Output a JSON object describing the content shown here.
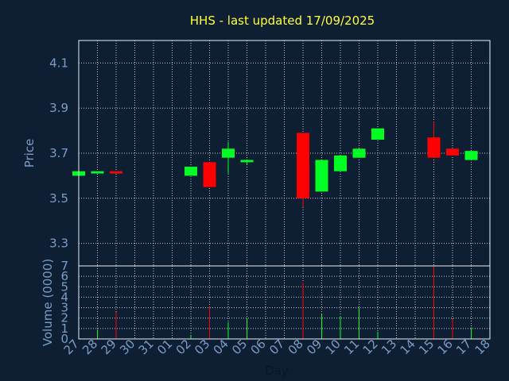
{
  "colors": {
    "background": "#0f1f33",
    "title": "#ffff33",
    "axis_text": "#7a9cc6",
    "up": "#00ff22",
    "down": "#ff0000",
    "frame": "#e8eef4"
  },
  "chart_data": [
    {
      "type": "candlestick",
      "title": "HHS - last updated 17/09/2025",
      "ylabel": "Price",
      "ylim": [
        3.2,
        4.2
      ],
      "yticks": [
        "3.3",
        "3.5",
        "3.7",
        "3.9",
        "4.1"
      ],
      "grid": true,
      "x_labels": [
        "27",
        "28",
        "29",
        "30",
        "31",
        "01",
        "02",
        "03",
        "04",
        "05",
        "06",
        "07",
        "08",
        "09",
        "10",
        "11",
        "12",
        "13",
        "14",
        "15",
        "16",
        "17",
        "18"
      ],
      "candles": [
        {
          "day": "27",
          "open": 3.6,
          "close": 3.62,
          "high": 3.62,
          "low": 3.6
        },
        {
          "day": "28",
          "open": 3.61,
          "close": 3.62,
          "high": 3.62,
          "low": 3.61
        },
        {
          "day": "29",
          "open": 3.62,
          "close": 3.61,
          "high": 3.62,
          "low": 3.61
        },
        {
          "day": "02",
          "open": 3.6,
          "close": 3.64,
          "high": 3.64,
          "low": 3.6
        },
        {
          "day": "03",
          "open": 3.66,
          "close": 3.55,
          "high": 3.66,
          "low": 3.55
        },
        {
          "day": "04",
          "open": 3.68,
          "close": 3.72,
          "high": 3.75,
          "low": 3.61
        },
        {
          "day": "05",
          "open": 3.66,
          "close": 3.67,
          "high": 3.67,
          "low": 3.65
        },
        {
          "day": "08",
          "open": 3.79,
          "close": 3.5,
          "high": 3.79,
          "low": 3.46
        },
        {
          "day": "09",
          "open": 3.53,
          "close": 3.67,
          "high": 3.67,
          "low": 3.53
        },
        {
          "day": "10",
          "open": 3.62,
          "close": 3.69,
          "high": 3.69,
          "low": 3.62
        },
        {
          "day": "11",
          "open": 3.68,
          "close": 3.72,
          "high": 3.72,
          "low": 3.68
        },
        {
          "day": "12",
          "open": 3.76,
          "close": 3.81,
          "high": 3.81,
          "low": 3.76
        },
        {
          "day": "15",
          "open": 3.77,
          "close": 3.68,
          "high": 3.84,
          "low": 3.68
        },
        {
          "day": "16",
          "open": 3.72,
          "close": 3.69,
          "high": 3.72,
          "low": 3.69
        },
        {
          "day": "17",
          "open": 3.67,
          "close": 3.71,
          "high": 3.71,
          "low": 3.67
        }
      ]
    },
    {
      "type": "bar",
      "ylabel": "Volume (0000)",
      "xlabel": "Day",
      "ylim": [
        0,
        7
      ],
      "yticks": [
        "0",
        "1",
        "2",
        "3",
        "4",
        "5",
        "6",
        "7"
      ],
      "grid": true,
      "bars": [
        {
          "day": "28",
          "value": 0.9,
          "direction": "up"
        },
        {
          "day": "29",
          "value": 2.6,
          "direction": "down"
        },
        {
          "day": "02",
          "value": 0.4,
          "direction": "up"
        },
        {
          "day": "03",
          "value": 3.1,
          "direction": "down"
        },
        {
          "day": "04",
          "value": 1.6,
          "direction": "up"
        },
        {
          "day": "05",
          "value": 2.0,
          "direction": "up"
        },
        {
          "day": "08",
          "value": 5.4,
          "direction": "down"
        },
        {
          "day": "09",
          "value": 2.4,
          "direction": "up"
        },
        {
          "day": "10",
          "value": 2.2,
          "direction": "up"
        },
        {
          "day": "11",
          "value": 3.0,
          "direction": "up"
        },
        {
          "day": "12",
          "value": 0.7,
          "direction": "up"
        },
        {
          "day": "15",
          "value": 7.0,
          "direction": "down"
        },
        {
          "day": "16",
          "value": 1.9,
          "direction": "down"
        },
        {
          "day": "17",
          "value": 1.1,
          "direction": "up"
        }
      ]
    }
  ]
}
